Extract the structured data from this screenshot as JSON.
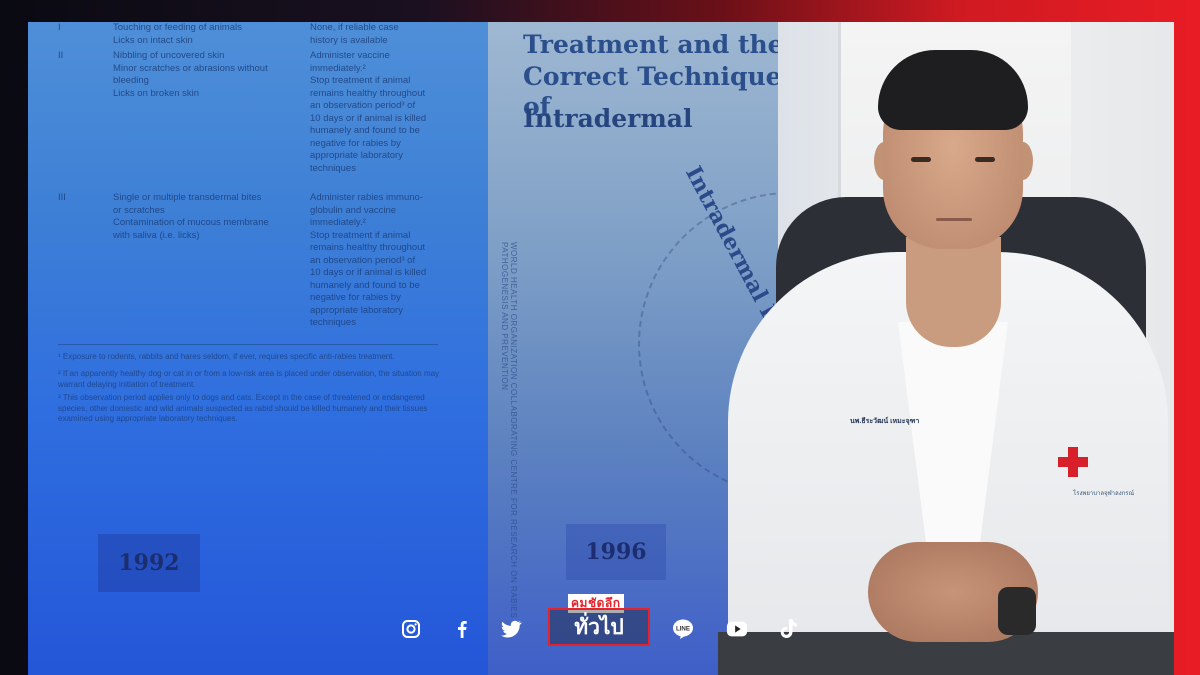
{
  "document": {
    "rows": [
      {
        "cat": "I",
        "exposure": "Touching or feeding of animals\nLicks on intact skin",
        "treatment": "None, if reliable case\nhistory is available"
      },
      {
        "cat": "II",
        "exposure": "Nibbling of uncovered skin\nMinor scratches or abrasions without\nbleeding\nLicks on broken skin",
        "treatment": "Administer vaccine\nimmediately.²\nStop treatment if animal\nremains healthy throughout\nan observation period³ of\n10 days or if animal is killed\nhumanely and found to be\nnegative for rabies by\nappropriate laboratory\ntechniques"
      },
      {
        "cat": "III",
        "exposure": "Single or multiple transdermal bites\nor scratches\nContamination of mucous membrane\nwith saliva (i.e. licks)",
        "treatment": "Administer rabies immuno-\nglobulin and vaccine\nimmediately.²\nStop treatment if animal\nremains healthy throughout\nan observation period³ of\n10 days or if animal is killed\nhumanely and found to be\nnegative for rabies by\nappropriate laboratory\ntechniques"
      }
    ],
    "notes": [
      "¹ Exposure to rodents, rabbits and hares seldom, if ever, requires specific anti-rabies treatment.",
      "² If an apparently healthy dog or cat in or from a low-risk area is placed under observation, the situation may warrant delaying initiation of treatment.",
      "³ This observation period applies only to dogs and cats. Except in the case of threatened or endangered species, other domestic and wild animals suspected as rabid should be killed humanely and their tissues examined using appropriate laboratory techniques."
    ],
    "year": "1992"
  },
  "cover": {
    "title_lines": [
      "Treatment and the",
      "Correct Technique of"
    ],
    "highlight": "Intradermal",
    "curved_text": "Intradermal Immunization against",
    "spine_text": "WORLD HEALTH ORGANIZATION COLLABORATING CENTRE FOR RESEARCH ON RABIES PATHOGENESIS AND PREVENTION",
    "year": "1996"
  },
  "photo": {
    "name_tag": "นพ.ธีระวัฒน์ เหมะจุฑา",
    "pocket_text": "โรงพยาบาลจุฬาลงกรณ์"
  },
  "social": {
    "icons": [
      "instagram-icon",
      "facebook-icon",
      "twitter-icon",
      "line-icon",
      "youtube-icon",
      "tiktok-icon"
    ],
    "brand": "คมชัดลึก",
    "category": "ทั่วไป",
    "line_label": "LINE"
  },
  "colors": {
    "accent_red": "#e8222a",
    "doc_blue": "#2f6ee0"
  }
}
